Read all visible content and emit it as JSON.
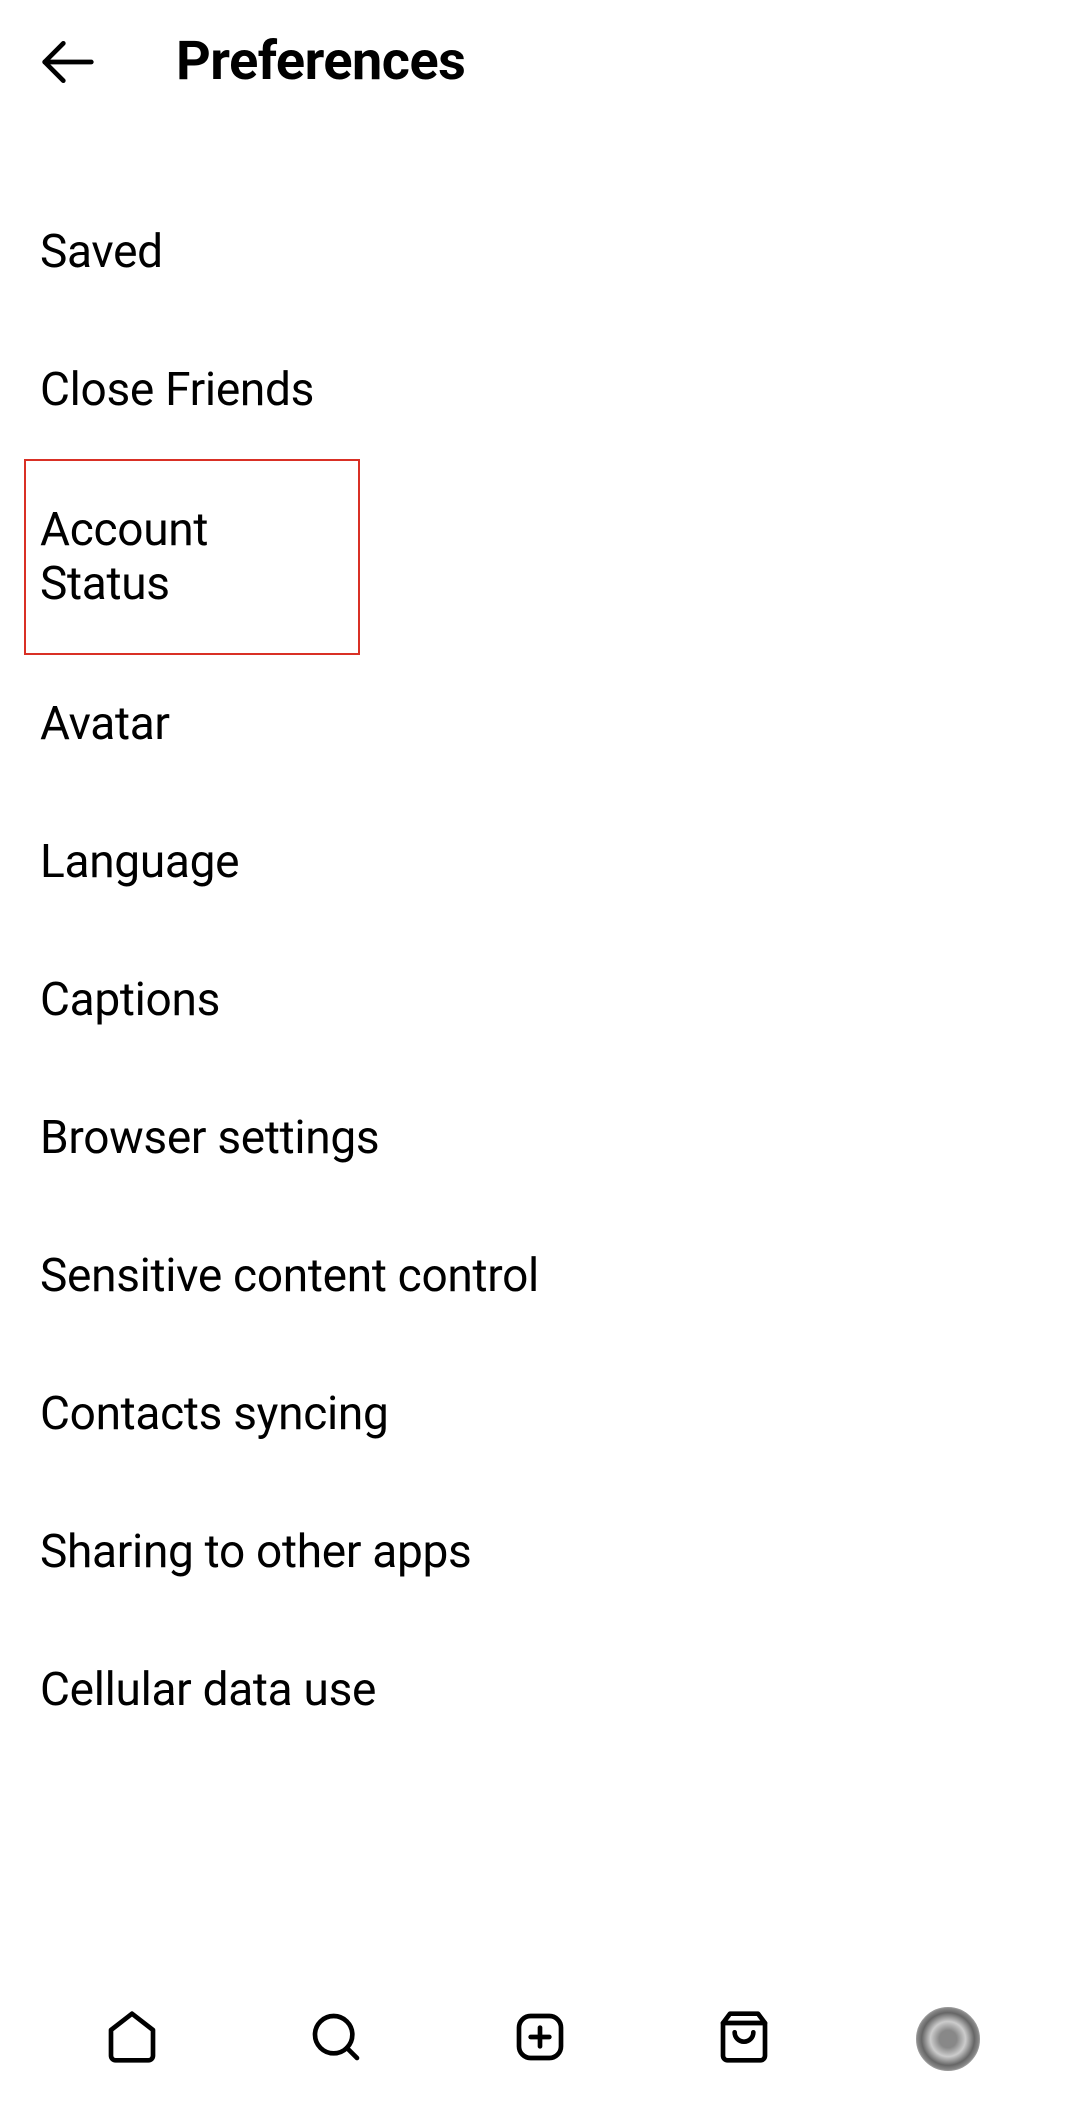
{
  "header": {
    "title": "Preferences"
  },
  "settings": {
    "items": [
      {
        "label": "Saved",
        "highlighted": false
      },
      {
        "label": "Close Friends",
        "highlighted": false
      },
      {
        "label": "Account Status",
        "highlighted": true
      },
      {
        "label": "Avatar",
        "highlighted": false
      },
      {
        "label": "Language",
        "highlighted": false
      },
      {
        "label": "Captions",
        "highlighted": false
      },
      {
        "label": "Browser settings",
        "highlighted": false
      },
      {
        "label": "Sensitive content control",
        "highlighted": false
      },
      {
        "label": "Contacts syncing",
        "highlighted": false
      },
      {
        "label": "Sharing to other apps",
        "highlighted": false
      },
      {
        "label": "Cellular data use",
        "highlighted": false
      }
    ]
  },
  "nav": {
    "icons": [
      "home",
      "search",
      "create",
      "shop",
      "profile"
    ]
  }
}
